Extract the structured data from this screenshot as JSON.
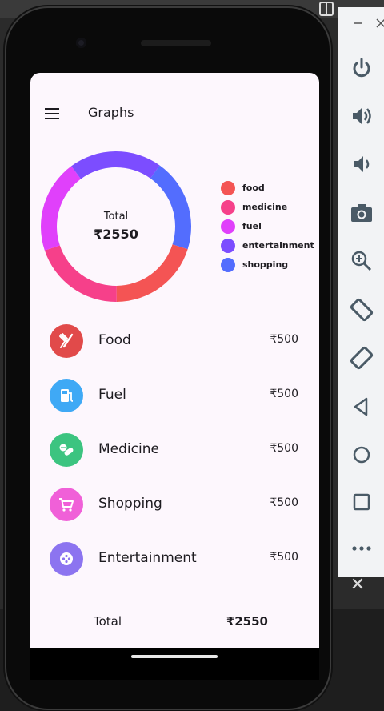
{
  "app": {
    "title": "Graphs",
    "menu_icon": "menu-icon",
    "currency": "₹"
  },
  "summary": {
    "total_label": "Total",
    "total_value": "₹2550"
  },
  "chart_data": {
    "type": "pie",
    "style": "donut",
    "center_label": "Total",
    "center_value": "₹2550",
    "legend_position": "right",
    "slices": [
      {
        "name": "food",
        "value": 500,
        "color": "#f45454"
      },
      {
        "name": "medicine",
        "value": 500,
        "color": "#f6408a"
      },
      {
        "name": "fuel",
        "value": 500,
        "color": "#e040fb"
      },
      {
        "name": "entertainment",
        "value": 500,
        "color": "#7c4dff"
      },
      {
        "name": "shopping",
        "value": 500,
        "color": "#536dfe"
      }
    ]
  },
  "legend": [
    {
      "label": "food",
      "color": "#f45454"
    },
    {
      "label": "medicine",
      "color": "#f6408a"
    },
    {
      "label": "fuel",
      "color": "#e040fb"
    },
    {
      "label": "entertainment",
      "color": "#7c4dff"
    },
    {
      "label": "shopping",
      "color": "#536dfe"
    }
  ],
  "expenses": [
    {
      "label": "Food",
      "amount": "₹500",
      "icon": "fork-knife-icon",
      "color": "#e14a4a"
    },
    {
      "label": "Fuel",
      "amount": "₹500",
      "icon": "fuel-pump-icon",
      "color": "#3fa9f5"
    },
    {
      "label": "Medicine",
      "amount": "₹500",
      "icon": "pills-icon",
      "color": "#3cc480"
    },
    {
      "label": "Shopping",
      "amount": "₹500",
      "icon": "shopping-cart-icon",
      "color": "#f060d8"
    },
    {
      "label": "Entertainment",
      "amount": "₹500",
      "icon": "gamepad-icon",
      "color": "#8c74f0"
    }
  ],
  "totals": {
    "label": "Total",
    "value": "₹2550"
  },
  "emulator_toolbar": {
    "buttons": [
      "power-icon",
      "volume-up-icon",
      "volume-down-icon",
      "camera-icon",
      "zoom-icon",
      "rotate-left-icon",
      "rotate-right-icon",
      "back-icon",
      "home-icon",
      "overview-icon",
      "more-icon"
    ],
    "close_icon": "close-icon"
  }
}
